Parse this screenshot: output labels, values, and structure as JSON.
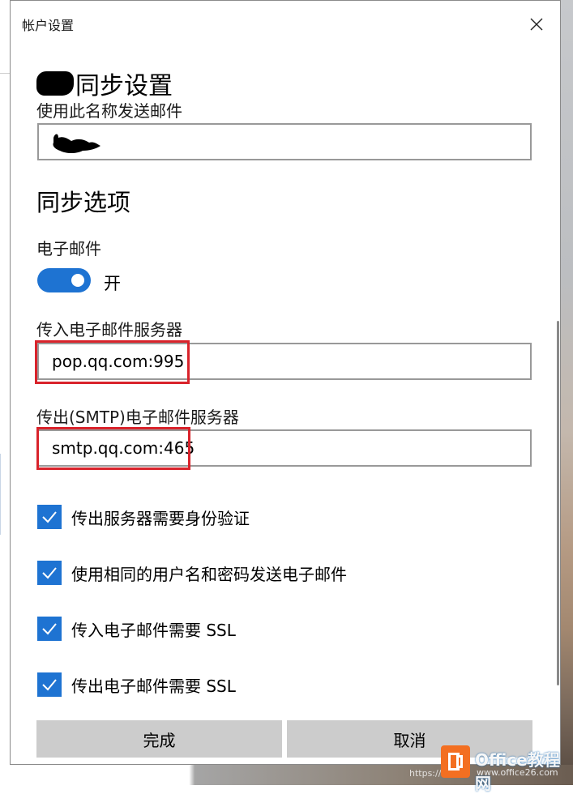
{
  "window": {
    "title": "帐户设置",
    "close_icon": "close-icon"
  },
  "account": {
    "heading_suffix": "同步设置",
    "sender_name_label": "使用此名称发送邮件",
    "sender_name_value": ""
  },
  "sync": {
    "section_title": "同步选项",
    "email_label": "电子邮件",
    "email_toggle_on": true,
    "email_toggle_state": "开"
  },
  "servers": {
    "incoming_label": "传入电子邮件服务器",
    "incoming_value": "pop.qq.com:995",
    "outgoing_label": "传出(SMTP)电子邮件服务器",
    "outgoing_value": "smtp.qq.com:465"
  },
  "options": [
    {
      "label": "传出服务器需要身份验证",
      "checked": true
    },
    {
      "label": "使用相同的用户名和密码发送电子邮件",
      "checked": true
    },
    {
      "label": "传入电子邮件需要 SSL",
      "checked": true
    },
    {
      "label": "传出电子邮件需要 SSL",
      "checked": true
    }
  ],
  "buttons": {
    "done": "完成",
    "cancel": "取消"
  },
  "watermark": {
    "brand": "Office教程网",
    "url": "www.office26.com",
    "page_url": "https://..."
  },
  "colors": {
    "accent": "#1e73d2",
    "highlight": "#d9232b",
    "button_bg": "#cccccc"
  }
}
